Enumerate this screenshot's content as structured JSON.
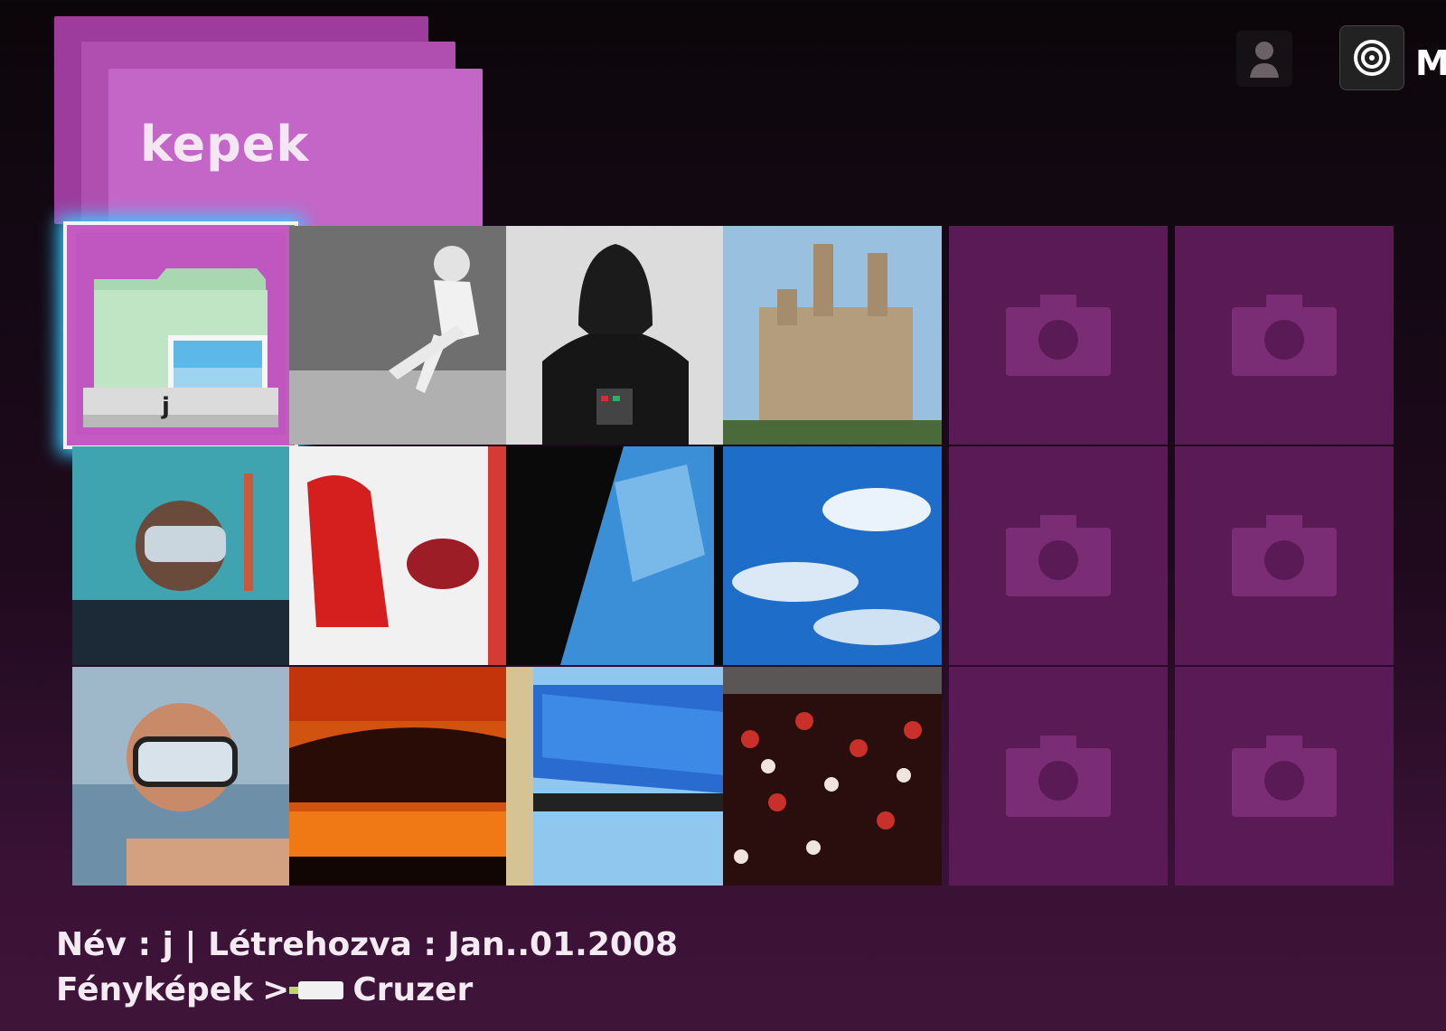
{
  "folder": {
    "title": "kepek"
  },
  "top_right": {
    "partial_label": "M"
  },
  "selected_item": {
    "label": "j"
  },
  "grid": {
    "tiles": [
      {
        "kind": "folder",
        "name": "folder-j"
      },
      {
        "kind": "photo",
        "name": "photo-footballer"
      },
      {
        "kind": "photo",
        "name": "photo-darth-vader"
      },
      {
        "kind": "photo",
        "name": "photo-cathedral"
      },
      {
        "kind": "placeholder",
        "name": "photo-placeholder"
      },
      {
        "kind": "placeholder",
        "name": "photo-placeholder"
      },
      {
        "kind": "photo",
        "name": "photo-diver"
      },
      {
        "kind": "photo",
        "name": "photo-red-jacket"
      },
      {
        "kind": "photo",
        "name": "photo-sky-window"
      },
      {
        "kind": "photo",
        "name": "photo-clouds"
      },
      {
        "kind": "placeholder",
        "name": "photo-placeholder"
      },
      {
        "kind": "placeholder",
        "name": "photo-placeholder"
      },
      {
        "kind": "photo",
        "name": "photo-snorkeler"
      },
      {
        "kind": "photo",
        "name": "photo-sunset"
      },
      {
        "kind": "photo",
        "name": "photo-blue-roof"
      },
      {
        "kind": "photo",
        "name": "photo-crowd"
      },
      {
        "kind": "placeholder",
        "name": "photo-placeholder"
      },
      {
        "kind": "placeholder",
        "name": "photo-placeholder"
      }
    ]
  },
  "info": {
    "name_label": "Név",
    "name_value": "j",
    "created_label": "Létrehozva",
    "created_value": "Jan..01.2008",
    "breadcrumb_root": "Fényképek",
    "breadcrumb_device": "Cruzer"
  },
  "colors": {
    "accent": "#36c9ff",
    "tile_placeholder": "#5a1a55",
    "folder_header": "#c466c8"
  }
}
